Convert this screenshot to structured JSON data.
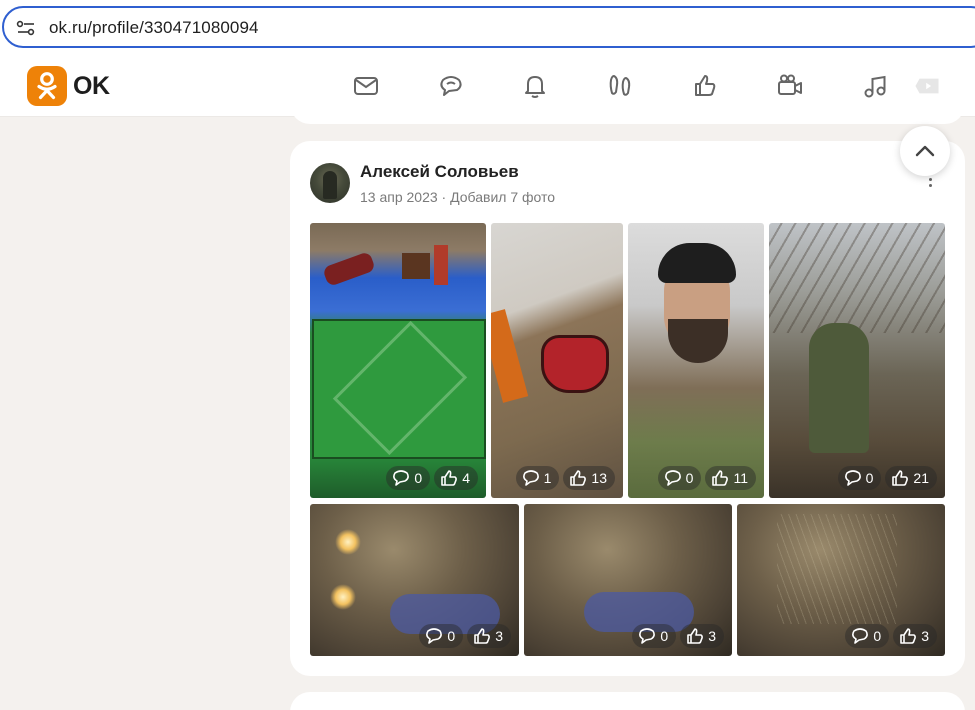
{
  "browser": {
    "url": "ok.ru/profile/330471080094"
  },
  "toolbar": {
    "logo_text": "OK",
    "brand_color": "#ee8208",
    "nav_icons": [
      "messages-icon",
      "discussions-icon",
      "notifications-icon",
      "guests-icon",
      "events-icon",
      "video-icon",
      "music-icon",
      "video-showcase-icon"
    ]
  },
  "post": {
    "author": "Алексей Соловьев",
    "date": "13 апр 2023",
    "separator": "·",
    "action": "Добавил 7 фото",
    "photos": [
      {
        "comments": "0",
        "likes": "4"
      },
      {
        "comments": "1",
        "likes": "13"
      },
      {
        "comments": "0",
        "likes": "11"
      },
      {
        "comments": "0",
        "likes": "21"
      },
      {
        "comments": "0",
        "likes": "3"
      },
      {
        "comments": "0",
        "likes": "3"
      },
      {
        "comments": "0",
        "likes": "3"
      }
    ]
  }
}
